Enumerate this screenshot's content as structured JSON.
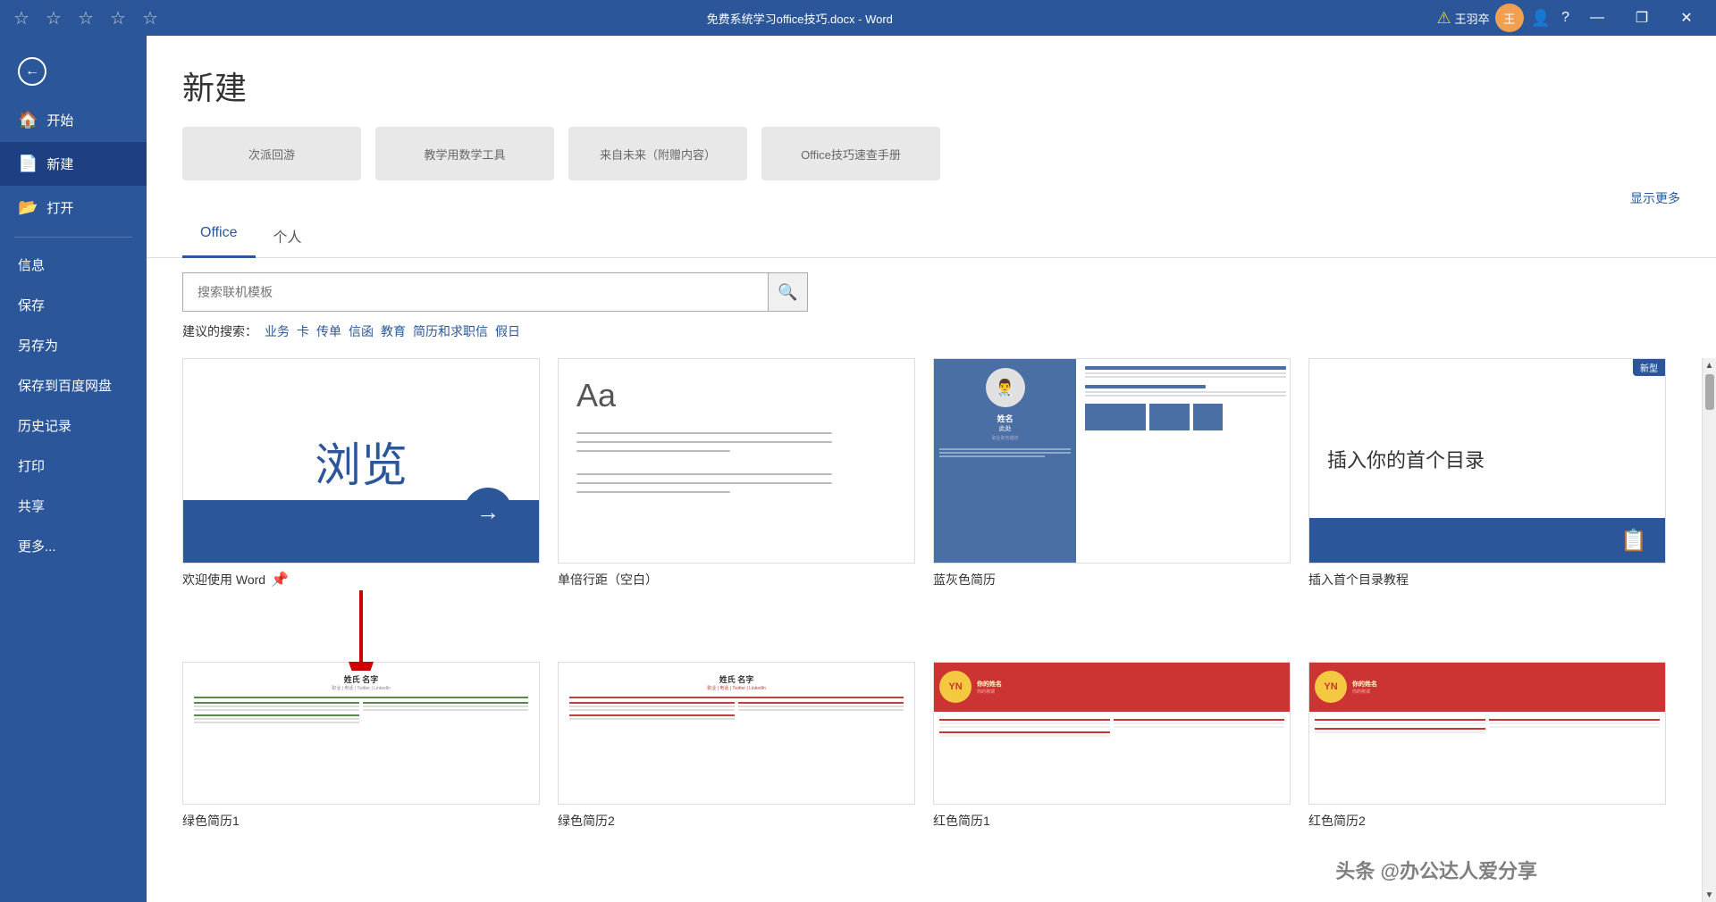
{
  "titlebar": {
    "title": "免费系统学习office技巧.docx  -  Word",
    "minimize": "—",
    "restore": "❐",
    "close": "✕",
    "warning_icon": "⚠",
    "user_name": "王羽卒",
    "help": "?"
  },
  "sidebar": {
    "back_label": "返回",
    "items": [
      {
        "id": "home",
        "icon": "🏠",
        "label": "开始"
      },
      {
        "id": "new",
        "icon": "📄",
        "label": "新建",
        "active": true
      },
      {
        "id": "open",
        "icon": "📂",
        "label": "打开"
      }
    ],
    "text_items": [
      {
        "id": "info",
        "label": "信息"
      },
      {
        "id": "save",
        "label": "保存"
      },
      {
        "id": "save-as",
        "label": "另存为"
      },
      {
        "id": "save-baidu",
        "label": "保存到百度网盘"
      },
      {
        "id": "history",
        "label": "历史记录"
      },
      {
        "id": "print",
        "label": "打印"
      },
      {
        "id": "share",
        "label": "共享"
      },
      {
        "id": "more",
        "label": "更多..."
      }
    ]
  },
  "content": {
    "page_title": "新建",
    "show_more": "显示更多",
    "tabs": [
      {
        "id": "office",
        "label": "Office",
        "active": true
      },
      {
        "id": "personal",
        "label": "个人"
      }
    ],
    "search": {
      "placeholder": "搜索联机模板",
      "search_icon": "🔍"
    },
    "suggested": {
      "label": "建议的搜索：",
      "items": [
        "业务",
        "卡",
        "传单",
        "信函",
        "教育",
        "简历和求职信",
        "假日"
      ]
    },
    "scroll_templates": [
      {
        "label": "次派回游"
      },
      {
        "label": "教学用数学工具"
      },
      {
        "label": "来自未来（附赠内容）"
      },
      {
        "label": "Office技巧速查手册"
      }
    ],
    "templates": [
      {
        "id": "welcome",
        "label": "欢迎使用 Word",
        "type": "welcome",
        "has_pin": true
      },
      {
        "id": "blank",
        "label": "单倍行距（空白）",
        "type": "blank",
        "has_pin": false
      },
      {
        "id": "resume-blue",
        "label": "蓝灰色简历",
        "type": "resume-blue",
        "has_pin": false
      },
      {
        "id": "toc",
        "label": "插入首个目录教程",
        "type": "toc",
        "badge": "新型",
        "has_pin": false
      },
      {
        "id": "resume-green1",
        "label": "绿色简历1",
        "type": "resume-green1",
        "has_pin": false
      },
      {
        "id": "resume-green2",
        "label": "绿色简历2",
        "type": "resume-green2",
        "has_pin": false
      },
      {
        "id": "resume-red1",
        "label": "红色简历1",
        "type": "resume-red1",
        "has_pin": false
      },
      {
        "id": "resume-red2",
        "label": "红色简历2",
        "type": "resume-red2",
        "has_pin": false
      }
    ],
    "watermark": "头条 @办公达人爱分享",
    "welcome_text": "浏览",
    "toc_text": "插入你的首个目录",
    "resume_name": "姓名 此处",
    "resume2_name1": "姓氏 名字",
    "resume2_name2": "姓氏 名字",
    "yn_text": "YN",
    "yn_title1": "你的姓名",
    "yn_title2": "你的姓名"
  },
  "colors": {
    "sidebar_bg": "#2b579a",
    "accent": "#2b579a",
    "active_tab_border": "#2b579a"
  }
}
